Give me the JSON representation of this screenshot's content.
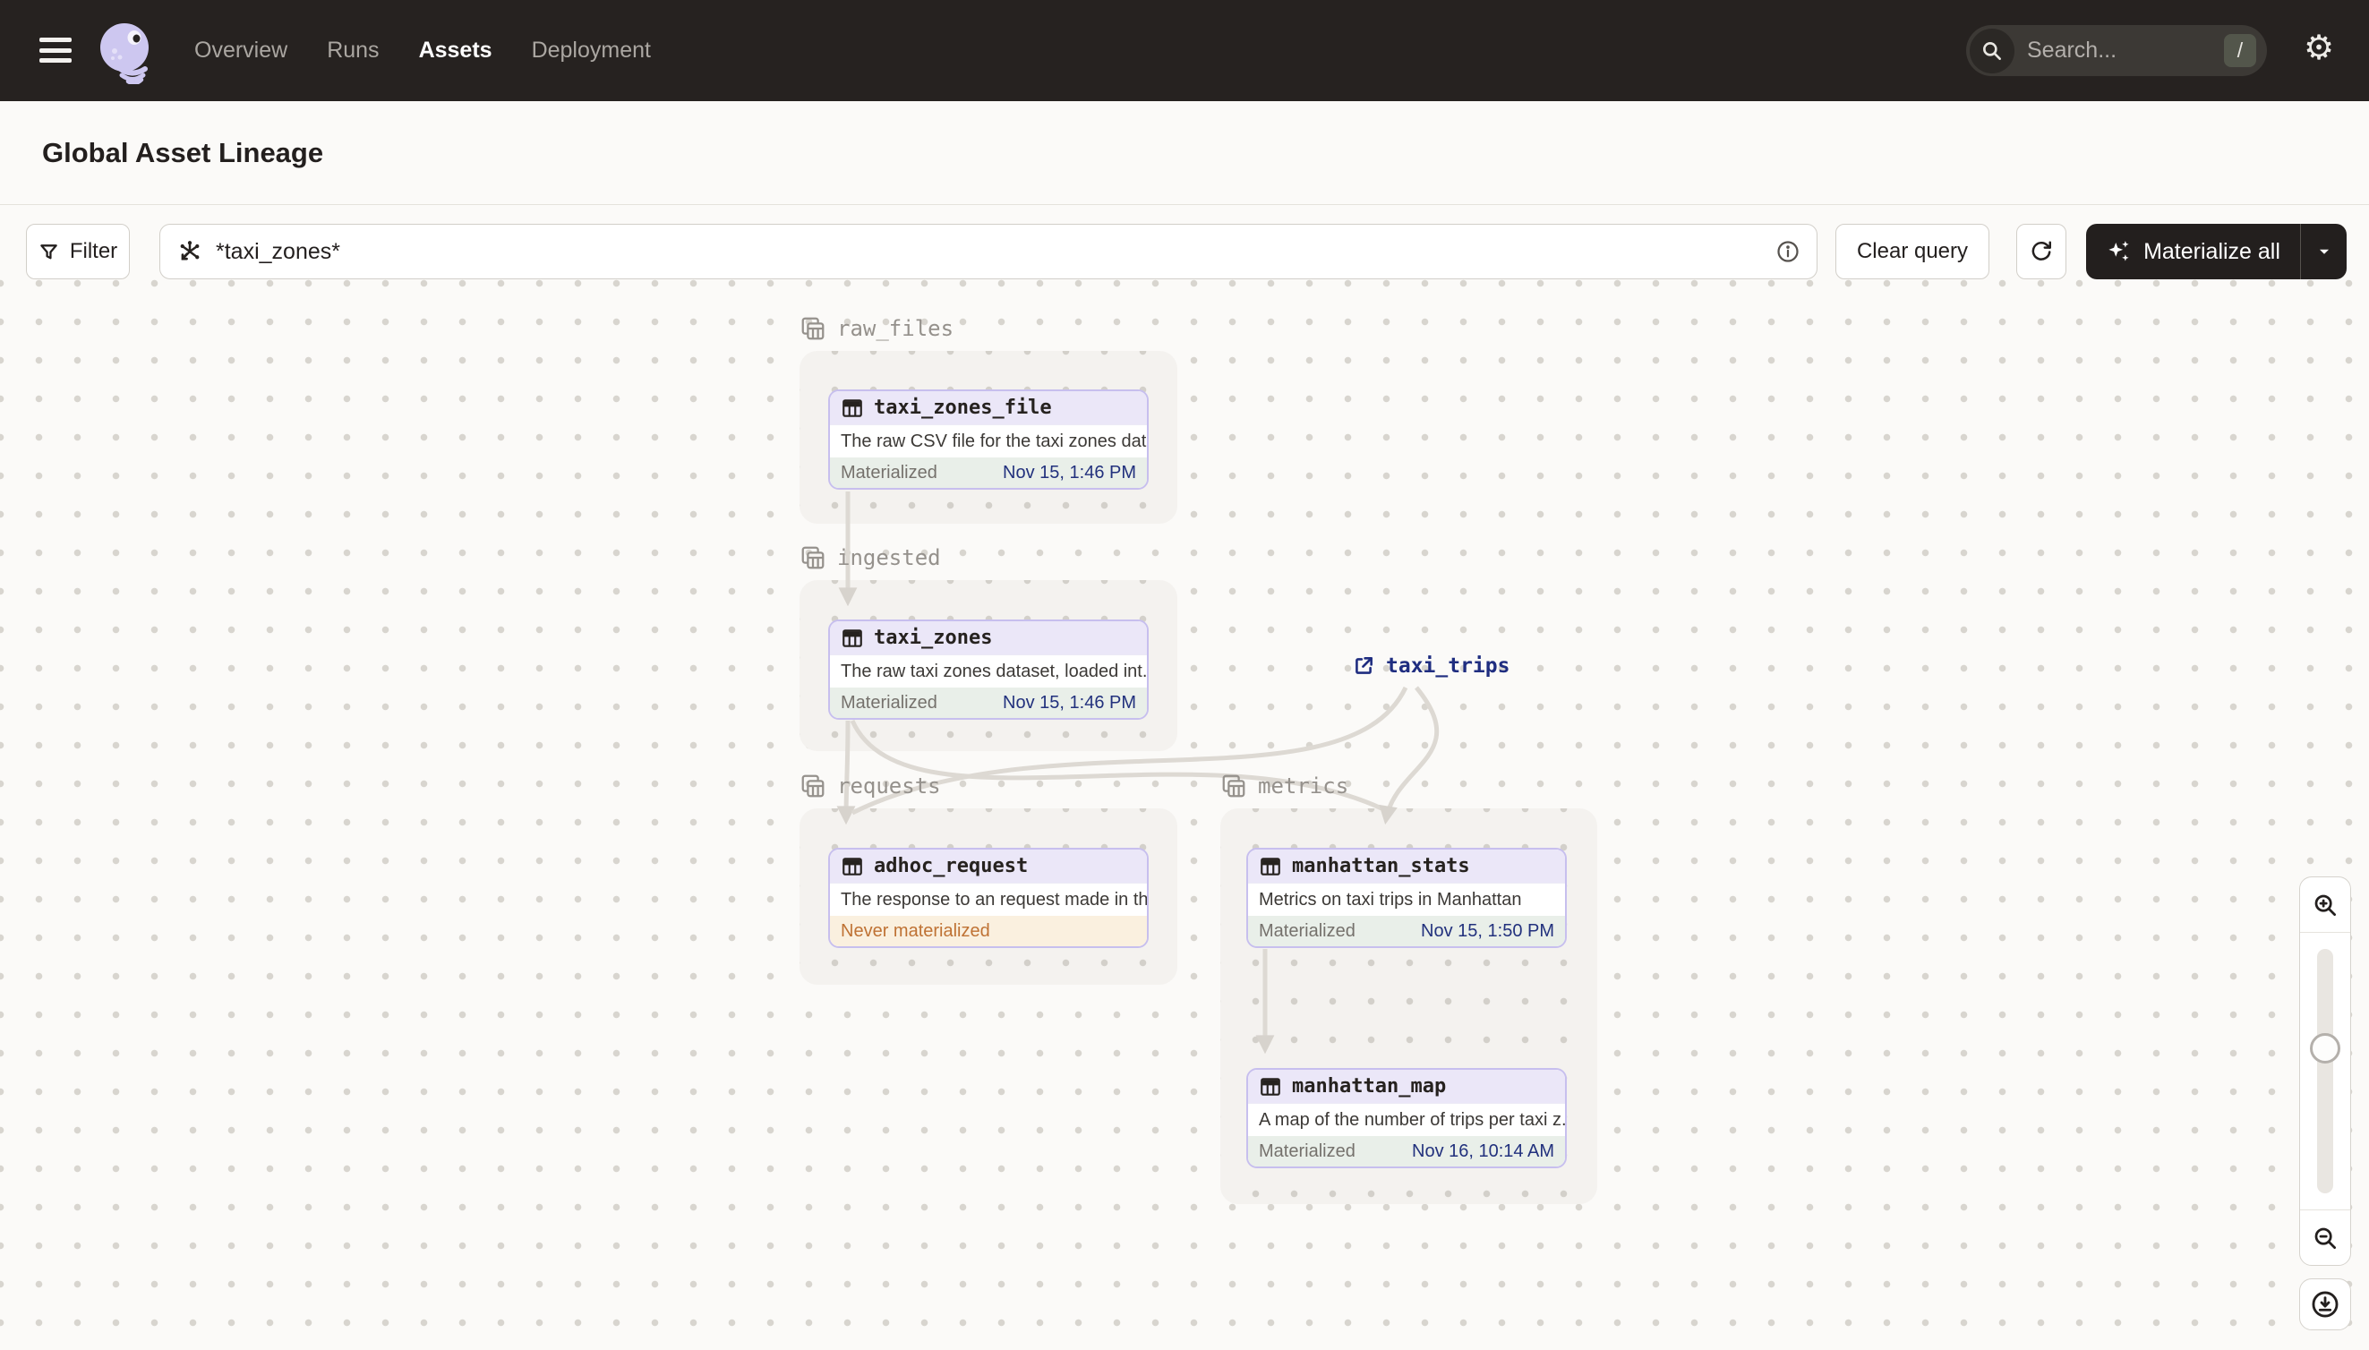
{
  "nav": {
    "items": [
      {
        "label": "Overview",
        "active": false
      },
      {
        "label": "Runs",
        "active": false
      },
      {
        "label": "Assets",
        "active": true
      },
      {
        "label": "Deployment",
        "active": false
      }
    ],
    "search": {
      "placeholder": "Search...",
      "shortcut": "/"
    }
  },
  "header": {
    "title": "Global Asset Lineage",
    "reload_label": "Reload definitions"
  },
  "toolbar": {
    "filter_label": "Filter",
    "query_value": "*taxi_zones*",
    "clear_label": "Clear query",
    "materialize_label": "Materialize all"
  },
  "graph": {
    "groups": [
      {
        "name": "raw_files"
      },
      {
        "name": "ingested"
      },
      {
        "name": "requests"
      },
      {
        "name": "metrics"
      }
    ],
    "nodes": [
      {
        "title": "taxi_zones_file",
        "description": "The raw CSV file for the taxi zones dat...",
        "status": {
          "label": "Materialized",
          "time": "Nov 15, 1:46 PM",
          "state": "materialized"
        }
      },
      {
        "title": "taxi_zones",
        "description": "The raw taxi zones dataset, loaded int...",
        "status": {
          "label": "Materialized",
          "time": "Nov 15, 1:46 PM",
          "state": "materialized"
        }
      },
      {
        "title": "adhoc_request",
        "description": "The response to an request made in th...",
        "status": {
          "label": "Never materialized",
          "time": "",
          "state": "never"
        }
      },
      {
        "title": "manhattan_stats",
        "description": "Metrics on taxi trips in Manhattan",
        "status": {
          "label": "Materialized",
          "time": "Nov 15, 1:50 PM",
          "state": "materialized"
        }
      },
      {
        "title": "manhattan_map",
        "description": "A map of the number of trips per taxi z...",
        "status": {
          "label": "Materialized",
          "time": "Nov 16, 10:14 AM",
          "state": "materialized"
        }
      }
    ],
    "external": [
      {
        "name": "taxi_trips"
      }
    ],
    "edges": [
      {
        "from": "taxi_zones_file",
        "to": "taxi_zones"
      },
      {
        "from": "taxi_zones",
        "to": "adhoc_request"
      },
      {
        "from": "taxi_zones",
        "to": "manhattan_stats"
      },
      {
        "from": "taxi_trips",
        "to": "adhoc_request"
      },
      {
        "from": "taxi_trips",
        "to": "manhattan_stats"
      },
      {
        "from": "manhattan_stats",
        "to": "manhattan_map"
      }
    ]
  },
  "colors": {
    "topnav_bg": "#262220",
    "page_bg": "#fbfaf8",
    "node_border": "#c7bfee",
    "node_header_bg": "#ebe7f8",
    "materialized_bg": "#e9efe9",
    "materialized_time": "#22317d",
    "never_materialized_bg": "#faf0df",
    "never_materialized_text": "#bf7234",
    "edge": "#ddd9d3",
    "group_bg": "#f4f2ef",
    "group_label": "#95918c",
    "dark_button_bg": "#231f1e",
    "external_link": "#1f2d80"
  }
}
